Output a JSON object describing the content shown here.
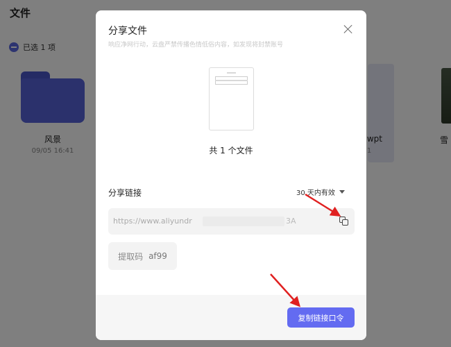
{
  "background": {
    "page_title": "文件",
    "selection_text": "已选 1 项",
    "tiles": [
      {
        "name": "风景",
        "date": "09/05 16:41"
      },
      {
        "name": ".wpt",
        "date": "1"
      },
      {
        "name": "雪",
        "date": ""
      }
    ]
  },
  "dialog": {
    "title": "分享文件",
    "warning": "响应净网行动，云盘严禁传播色情低俗内容，如发现将封禁账号",
    "file_count": "共 1 个文件",
    "share_link_label": "分享链接",
    "validity": "30 天内有效",
    "link_url_visible": "https://www.aliyundr",
    "link_url_suffix": "3A",
    "extract_code_label": "提取码",
    "extract_code_value": "af99",
    "copy_button_label": "复制链接口令"
  },
  "colors": {
    "accent": "#636bf1",
    "folder": "#5663d8",
    "annotation": "#e02020"
  },
  "icons": [
    "deselect-icon",
    "folder-icon",
    "close-icon",
    "chevron-down-icon",
    "copy-icon"
  ]
}
